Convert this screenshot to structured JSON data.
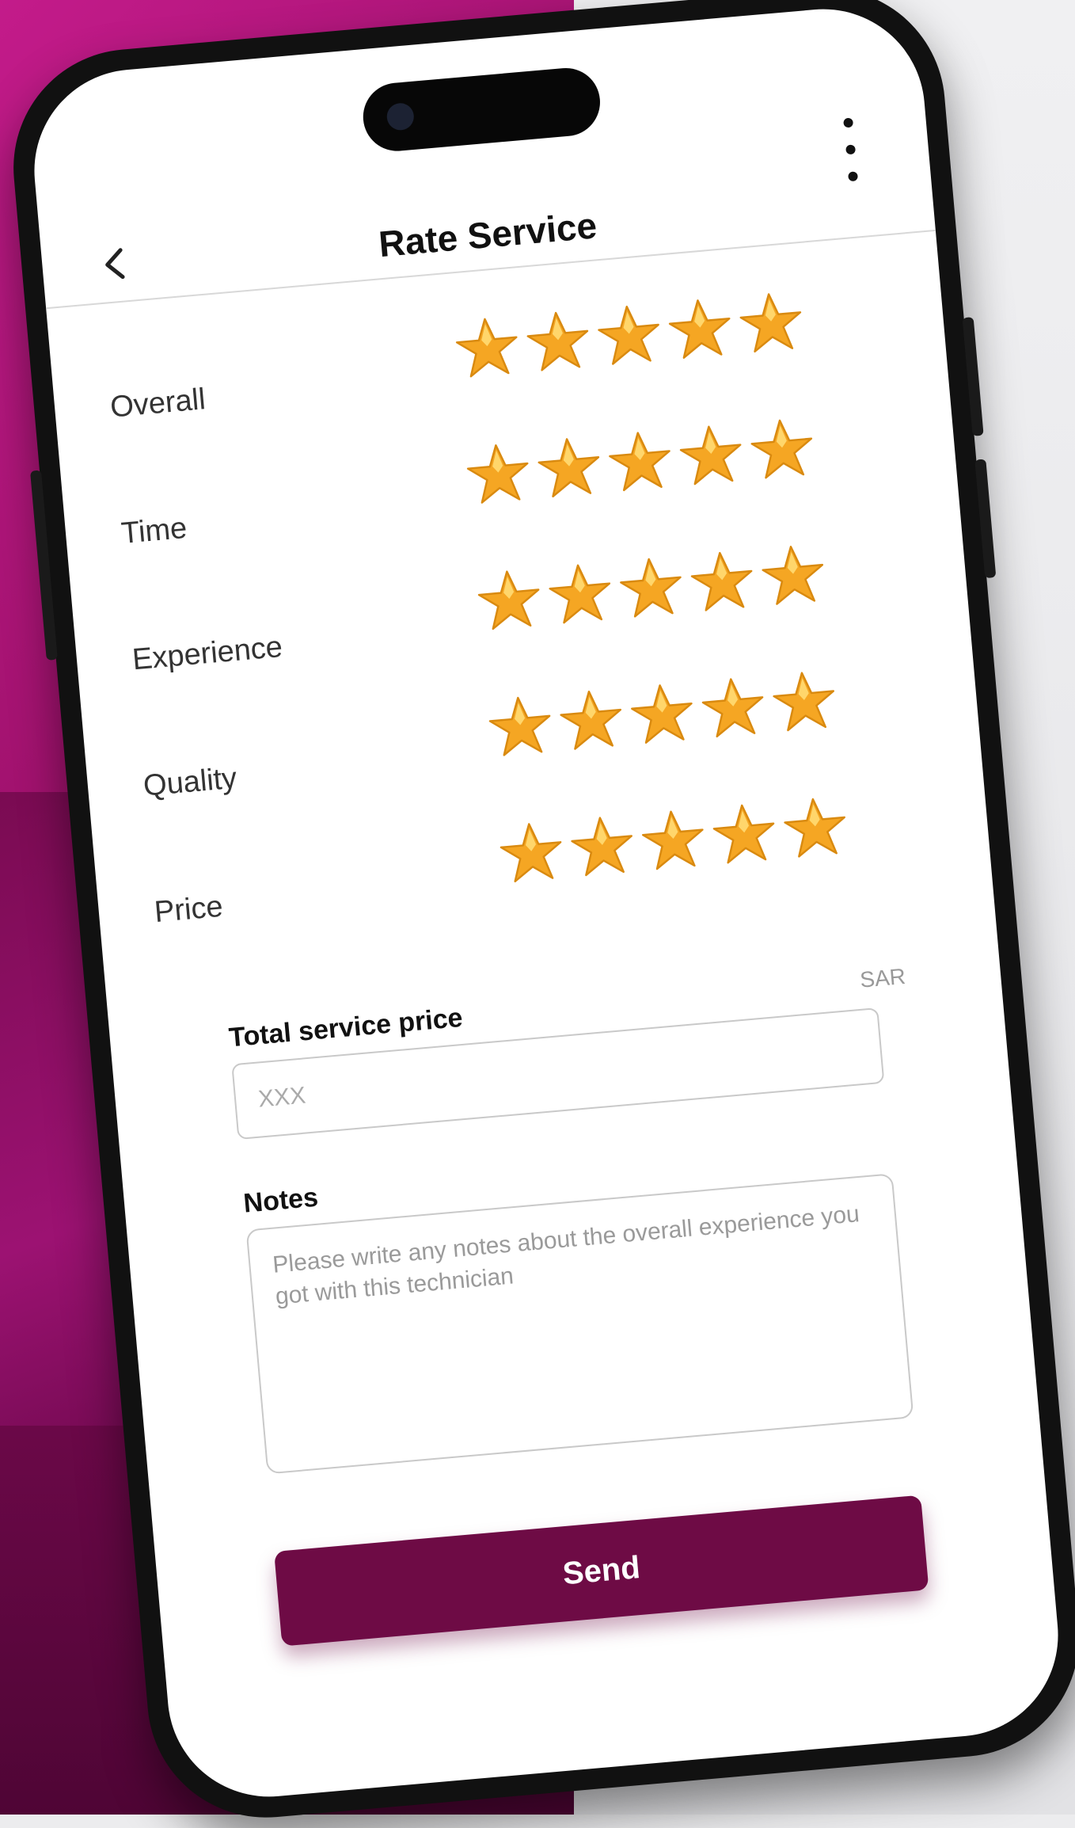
{
  "header": {
    "title": "Rate Service",
    "back_icon": "chevron-left-icon",
    "more_icon": "more-vertical-icon"
  },
  "ratings": [
    {
      "label": "Overall",
      "stars": 5,
      "max": 5
    },
    {
      "label": "Time",
      "stars": 5,
      "max": 5
    },
    {
      "label": "Experience",
      "stars": 5,
      "max": 5
    },
    {
      "label": "Quality",
      "stars": 5,
      "max": 5
    },
    {
      "label": "Price",
      "stars": 5,
      "max": 5
    }
  ],
  "price": {
    "label": "Total service price",
    "currency": "SAR",
    "placeholder": "XXX",
    "value": ""
  },
  "notes": {
    "label": "Notes",
    "placeholder": "Please write any notes about the overall experience you got with this technician",
    "value": ""
  },
  "send_label": "Send",
  "colors": {
    "brand": "#6e0b45",
    "star": "#f5a623",
    "background_left": "#9c1272",
    "background_right": "#ececee"
  }
}
